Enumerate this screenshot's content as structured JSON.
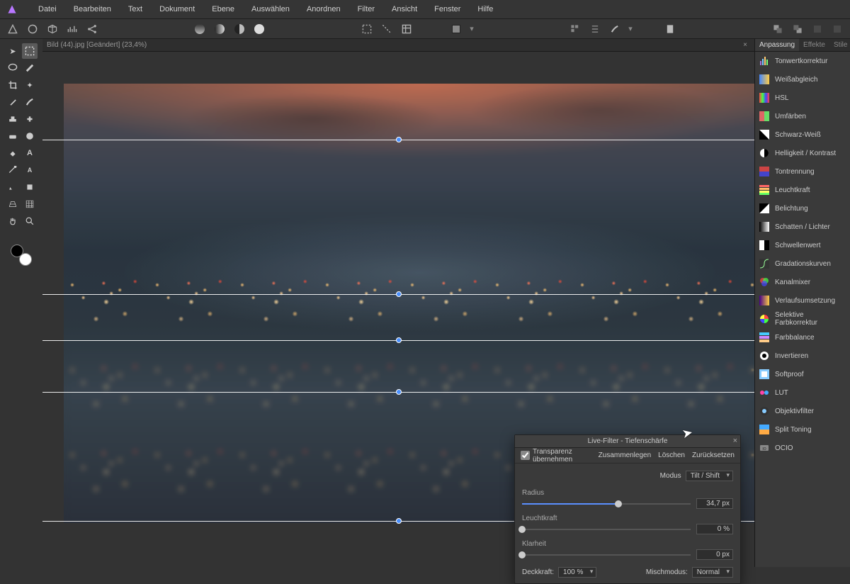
{
  "menu": [
    "Datei",
    "Bearbeiten",
    "Text",
    "Dokument",
    "Ebene",
    "Auswählen",
    "Anordnen",
    "Filter",
    "Ansicht",
    "Fenster",
    "Hilfe"
  ],
  "doc_tab": "Bild (44).jpg [Geändert] (23,4%)",
  "panel_tabs": {
    "anpassung": "Anpassung",
    "effekte": "Effekte",
    "stile": "Stile"
  },
  "adjustments": [
    {
      "label": "Tonwertkorrektur",
      "icon": "levels"
    },
    {
      "label": "Weißabgleich",
      "icon": "wb"
    },
    {
      "label": "HSL",
      "icon": "hsl"
    },
    {
      "label": "Umfärben",
      "icon": "recolor"
    },
    {
      "label": "Schwarz-Weiß",
      "icon": "bw"
    },
    {
      "label": "Helligkeit / Kontrast",
      "icon": "bc"
    },
    {
      "label": "Tontrennung",
      "icon": "posterize"
    },
    {
      "label": "Leuchtkraft",
      "icon": "vibrance"
    },
    {
      "label": "Belichtung",
      "icon": "exposure"
    },
    {
      "label": "Schatten / Lichter",
      "icon": "shad"
    },
    {
      "label": "Schwellenwert",
      "icon": "thresh"
    },
    {
      "label": "Gradationskurven",
      "icon": "curves"
    },
    {
      "label": "Kanalmixer",
      "icon": "chmix"
    },
    {
      "label": "Verlaufsumsetzung",
      "icon": "gradmap"
    },
    {
      "label": "Selektive Farbkorrektur",
      "icon": "selcol"
    },
    {
      "label": "Farbbalance",
      "icon": "cbal"
    },
    {
      "label": "Invertieren",
      "icon": "invert"
    },
    {
      "label": "Softproof",
      "icon": "soft"
    },
    {
      "label": "LUT",
      "icon": "lut"
    },
    {
      "label": "Objektivfilter",
      "icon": "lens"
    },
    {
      "label": "Split Toning",
      "icon": "split"
    },
    {
      "label": "OCIO",
      "icon": "ocio"
    }
  ],
  "dialog": {
    "title": "Live-Filter - Tiefenschärfe",
    "transparent": "Transparenz übernehmen",
    "merge": "Zusammenlegen",
    "delete": "Löschen",
    "reset": "Zurücksetzen",
    "mode_label": "Modus",
    "mode_value": "Tilt / Shift",
    "radius_label": "Radius",
    "radius_value": "34,7 px",
    "radius_pct": 57,
    "vibrance_label": "Leuchtkraft",
    "vibrance_value": "0 %",
    "vibrance_pct": 0,
    "clarity_label": "Klarheit",
    "clarity_value": "0 px",
    "clarity_pct": 0,
    "opacity_label": "Deckkraft:",
    "opacity_value": "100 %",
    "blendmode_label": "Mischmodus:",
    "blendmode_value": "Normal"
  },
  "tiltshift_lines_pct": [
    17,
    47,
    56,
    66,
    91
  ],
  "tiltshift_handle_x_pct": 50
}
